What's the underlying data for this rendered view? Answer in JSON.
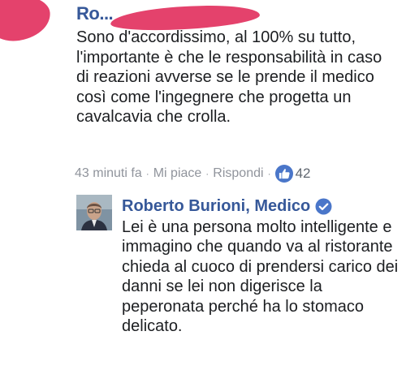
{
  "comment": {
    "author": "Ro...",
    "text": "Sono d'accordissimo, al 100% su tutto, l'importante è che le responsabilità in caso di reazioni avverse se le prende il medico così come l'ingegnere che progetta un cavalcavia che crolla.",
    "timestamp": "43 minuti fa",
    "like_label": "Mi piace",
    "reply_label": "Rispondi",
    "separator": "·",
    "like_count": "42",
    "colors": {
      "redaction": "#e4426c",
      "author": "#365899",
      "meta": "#90949c"
    }
  },
  "reply": {
    "author": "Roberto Burioni, Medico",
    "verified_icon": "verified-badge-icon",
    "text": "Lei è una persona molto intelligente e immagino che quando va al ristorante chieda al cuoco di prendersi carico dei danni se lei non digerisce la peperonata perché ha lo stomaco delicato."
  }
}
